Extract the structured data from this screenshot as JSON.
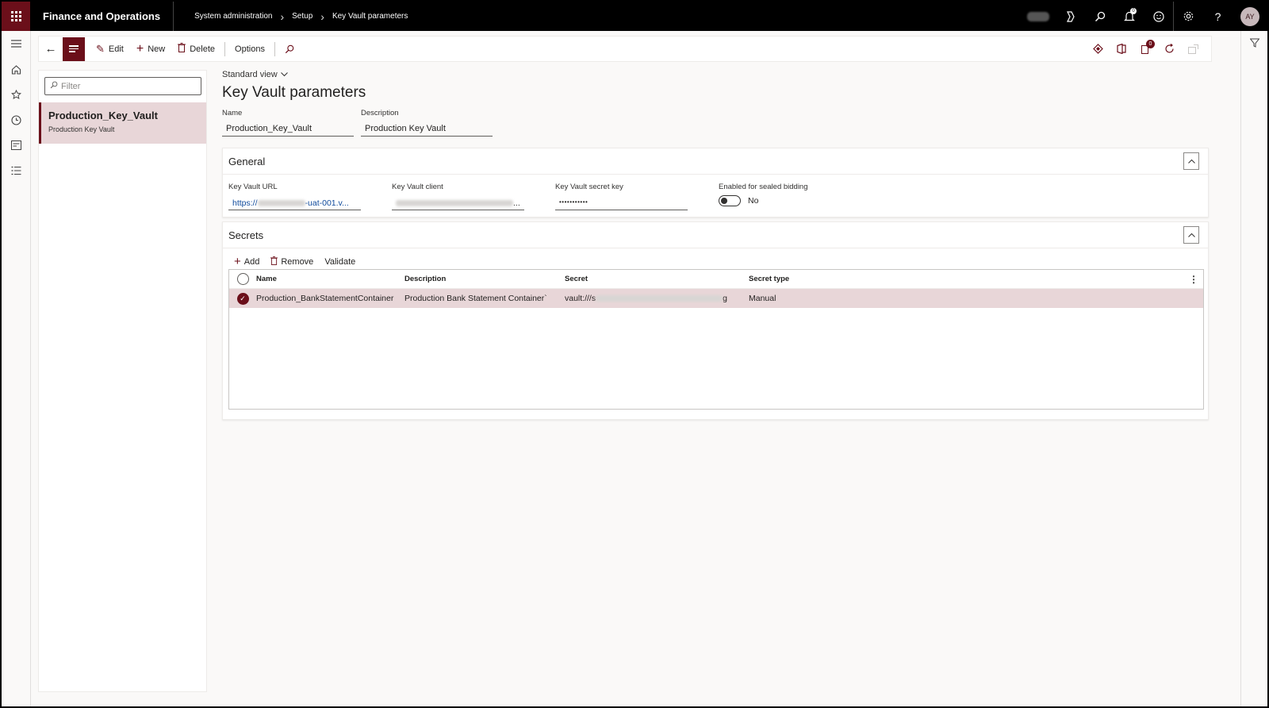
{
  "app": {
    "title": "Finance and Operations",
    "breadcrumbs": [
      "System administration",
      "Setup",
      "Key Vault parameters"
    ],
    "avatar_initials": "AY",
    "notification_count": "0",
    "accent_color": "#6b0f1a"
  },
  "topbar_icons": [
    "copilot-icon",
    "search-icon",
    "bell-icon",
    "feedback-icon",
    "gear-icon",
    "help-icon"
  ],
  "toolbar": {
    "edit_label": "Edit",
    "new_label": "New",
    "delete_label": "Delete",
    "options_label": "Options",
    "right_badge_count": "0"
  },
  "listpanel": {
    "filter_placeholder": "Filter",
    "items": [
      {
        "title": "Production_Key_Vault",
        "subtitle": "Production Key Vault"
      }
    ]
  },
  "page": {
    "view_label": "Standard view",
    "title": "Key Vault parameters",
    "name_label": "Name",
    "name_value": "Production_Key_Vault",
    "description_label": "Description",
    "description_value": "Production Key Vault"
  },
  "general": {
    "header": "General",
    "url_label": "Key Vault URL",
    "url_prefix": "https://",
    "url_suffix": "-uat-001.v...",
    "client_label": "Key Vault client",
    "client_suffix": "...",
    "secret_key_label": "Key Vault secret key",
    "secret_key_value": "•••••••••••",
    "sealed_label": "Enabled for sealed bidding",
    "sealed_value": "No"
  },
  "secrets": {
    "header": "Secrets",
    "add_label": "Add",
    "remove_label": "Remove",
    "validate_label": "Validate",
    "columns": [
      "Name",
      "Description",
      "Secret",
      "Secret type"
    ],
    "rows": [
      {
        "name": "Production_BankStatementContainer",
        "description": "Production Bank Statement Container`",
        "secret_prefix": "vault:///s",
        "secret_suffix": "g",
        "secret_type": "Manual"
      }
    ]
  }
}
